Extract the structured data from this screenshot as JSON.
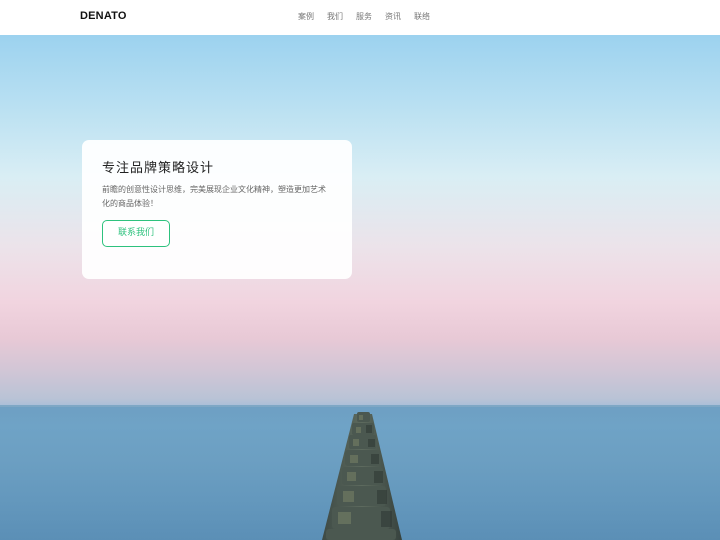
{
  "header": {
    "logo": "DENATO",
    "nav": [
      "案例",
      "我们",
      "服务",
      "资讯",
      "联络"
    ]
  },
  "hero": {
    "title": "专注品牌策略设计",
    "description": "前瞻的创意性设计思维，完美展现企业文化精神，塑造更加艺术化的商品体验！",
    "button_label": "联系我们"
  },
  "colors": {
    "accent": "#2ec27e",
    "sky_top": "#9cd2ef",
    "sky_pink": "#f1d4df",
    "sea": "#6e9fc3"
  }
}
